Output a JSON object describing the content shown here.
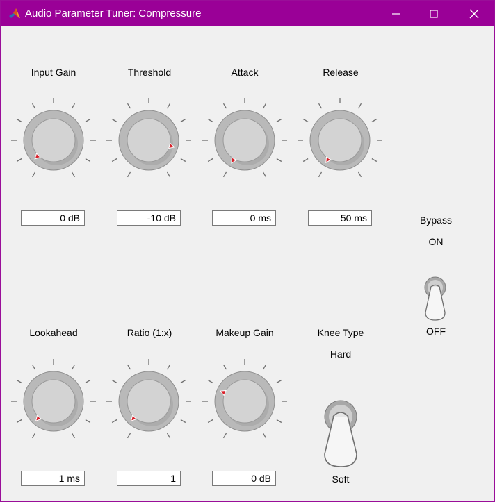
{
  "window": {
    "title": "Audio Parameter Tuner: Compressure",
    "title_bar_color": "#9a0097",
    "icon": "matlab-logo-icon",
    "controls": [
      "minimize-icon",
      "maximize-icon",
      "close-icon"
    ]
  },
  "knobs": [
    {
      "id": "input-gain",
      "label": "Input Gain",
      "value": "0 dB",
      "pointer_angle_deg": 225
    },
    {
      "id": "threshold",
      "label": "Threshold",
      "value": "-10 dB",
      "pointer_angle_deg": 105
    },
    {
      "id": "attack",
      "label": "Attack",
      "value": "0 ms",
      "pointer_angle_deg": 210
    },
    {
      "id": "release",
      "label": "Release",
      "value": "50 ms",
      "pointer_angle_deg": 212
    },
    {
      "id": "lookahead",
      "label": "Lookahead",
      "value": "1 ms",
      "pointer_angle_deg": 222
    },
    {
      "id": "ratio",
      "label": "Ratio (1:x)",
      "value": "1",
      "pointer_angle_deg": 222
    },
    {
      "id": "makeup-gain",
      "label": "Makeup Gain",
      "value": "0 dB",
      "pointer_angle_deg": 293
    }
  ],
  "switches": {
    "bypass": {
      "label": "Bypass",
      "on_label": "ON",
      "off_label": "OFF",
      "state": "OFF"
    },
    "knee": {
      "label": "Knee Type",
      "on_label": "Hard",
      "off_label": "Soft",
      "state": "Soft"
    }
  },
  "colors": {
    "pointer": "#d8202a",
    "knob_face": "#d3d3d3",
    "knob_ring": "#b9b9b9"
  }
}
